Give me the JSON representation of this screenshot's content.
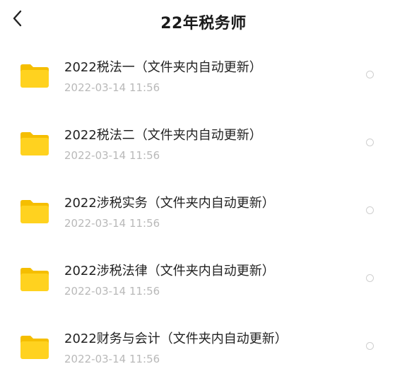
{
  "header": {
    "title": "22年税务师",
    "back_icon": "chevron-left-icon"
  },
  "folder_icon": "folder-icon",
  "colors": {
    "folder": "#FFD21F",
    "folder_tab": "#F5BE00",
    "text": "#222222",
    "date": "#B9B9B9",
    "radio_border": "#CFCFCF"
  },
  "files": [
    {
      "name": "2022税法一（文件夹内自动更新）",
      "date": "2022-03-14 11:56",
      "selected": false
    },
    {
      "name": "2022税法二（文件夹内自动更新）",
      "date": "2022-03-14 11:56",
      "selected": false
    },
    {
      "name": "2022涉税实务（文件夹内自动更新）",
      "date": "2022-03-14 11:56",
      "selected": false
    },
    {
      "name": "2022涉税法律（文件夹内自动更新）",
      "date": "2022-03-14 11:56",
      "selected": false
    },
    {
      "name": "2022财务与会计（文件夹内自动更新）",
      "date": "2022-03-14 11:56",
      "selected": false
    }
  ]
}
